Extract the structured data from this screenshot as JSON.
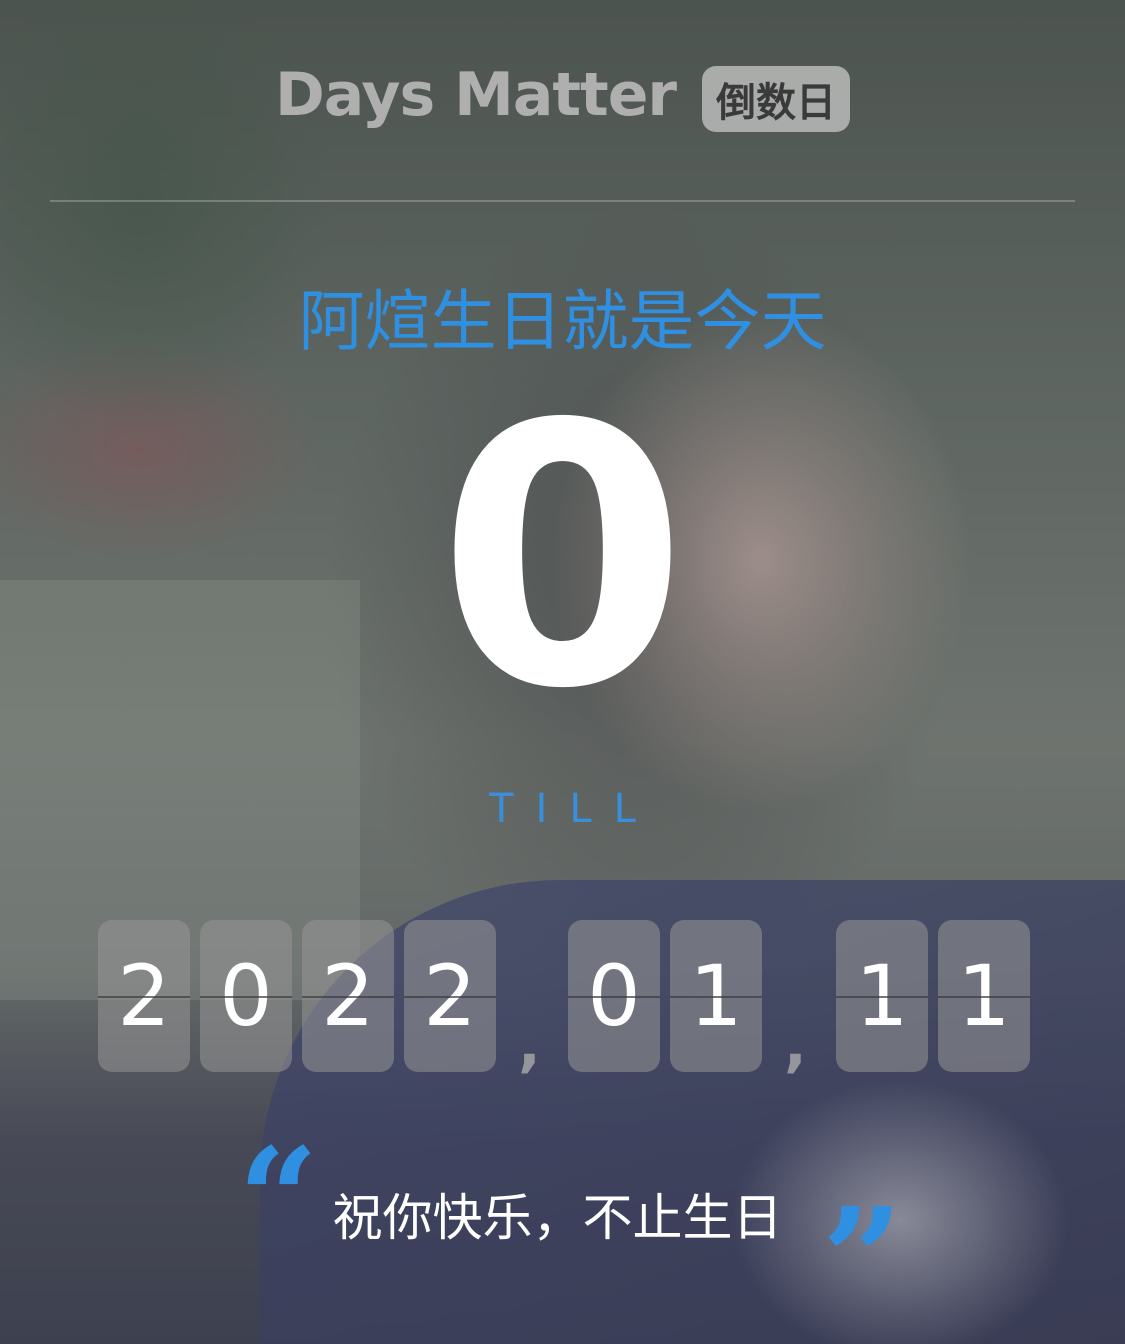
{
  "header": {
    "app_name": "Days Matter",
    "badge": "倒数日"
  },
  "event": {
    "title": "阿煊生日就是今天",
    "days": "0",
    "till_label": "TILL"
  },
  "date": {
    "digits": [
      "2",
      "0",
      "2",
      "2",
      "0",
      "1",
      "1",
      "1"
    ],
    "separator": ","
  },
  "quote": {
    "open_mark": "“",
    "close_mark": "”",
    "message": "祝你快乐，不止生日"
  },
  "colors": {
    "accent": "#2f8fe0",
    "count": "#ffffff"
  }
}
